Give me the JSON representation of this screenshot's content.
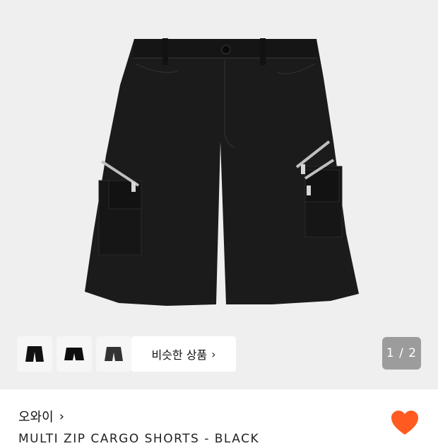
{
  "gallery": {
    "image_alt": "Black cargo shorts with zip pockets",
    "thumbnails": [
      "thumb-1",
      "thumb-2",
      "thumb-3"
    ],
    "similar_label": "비슷한 상품",
    "similar_chevron": "›",
    "counter": "1 / 2"
  },
  "product": {
    "brand": "오와이",
    "brand_chevron": "›",
    "name": "MULTI ZIP CARGO SHORTS - BLACK"
  },
  "colors": {
    "accent": "#ff5a1f",
    "garment": "#1b1b1b"
  },
  "icons": {
    "like": "heart-icon"
  }
}
